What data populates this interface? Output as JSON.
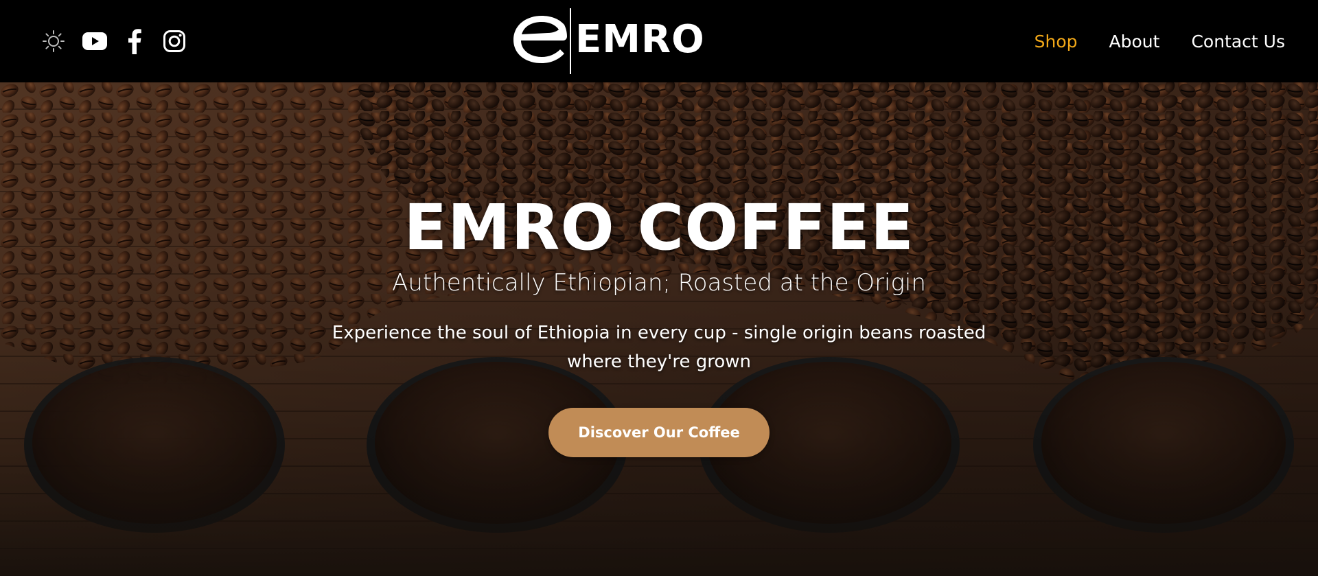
{
  "header": {
    "social": [
      {
        "icon": "sun-icon",
        "label": "theme toggle"
      },
      {
        "icon": "youtube-icon",
        "label": "YouTube"
      },
      {
        "icon": "facebook-icon",
        "label": "Facebook"
      },
      {
        "icon": "instagram-icon",
        "label": "Instagram"
      }
    ],
    "logo_text": "EMRO",
    "nav": [
      {
        "label": "Shop",
        "active": true
      },
      {
        "label": "About",
        "active": false
      },
      {
        "label": "Contact Us",
        "active": false
      }
    ]
  },
  "hero": {
    "title": "EMRO COFFEE",
    "subtitle": "Authentically Ethiopian; Roasted at the Origin",
    "description": "Experience the soul of Ethiopia in every cup - single origin beans roasted where they're grown",
    "cta_label": "Discover Our Coffee"
  },
  "colors": {
    "header_bg": "#000000",
    "nav_active": "#f2a818",
    "nav_text": "#ffffff",
    "cta_bg": "#c18c56"
  }
}
